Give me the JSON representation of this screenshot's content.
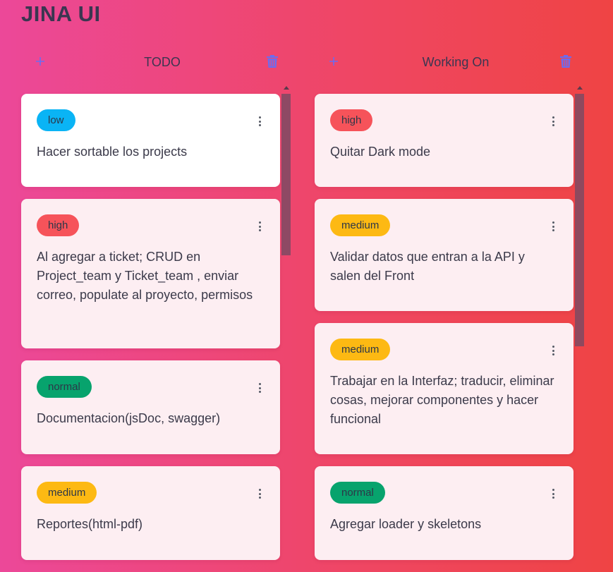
{
  "app": {
    "title": "JINA UI"
  },
  "colors": {
    "add_icon": "#6b6cf0",
    "trash_icon": "#6b6cf0",
    "title": "#3b3651"
  },
  "columns": [
    {
      "title": "TODO",
      "add_icon": "plus-icon",
      "delete_icon": "trash-icon",
      "scroll_position": 0,
      "cards": [
        {
          "priority": "low",
          "text": "Hacer sortable los projects"
        },
        {
          "priority": "high",
          "text": "Al agregar a ticket; CRUD en Project_team y Ticket_team , enviar correo, populate al proyecto, permisos"
        },
        {
          "priority": "normal",
          "text": "Documentacion(jsDoc, swagger)"
        },
        {
          "priority": "medium",
          "text": "Reportes(html-pdf)"
        }
      ]
    },
    {
      "title": "Working On",
      "add_icon": "plus-icon",
      "delete_icon": "trash-icon",
      "scroll_position": 0,
      "cards": [
        {
          "priority": "high",
          "text": "Quitar Dark mode"
        },
        {
          "priority": "medium",
          "text": "Validar datos que entran a la API y salen del Front"
        },
        {
          "priority": "medium",
          "text": "Trabajar en la Interfaz; traducir, eliminar cosas, mejorar componentes y hacer funcional"
        },
        {
          "priority": "normal",
          "text": "Agregar loader y skeletons"
        }
      ]
    }
  ],
  "card_menu_icon": "more-vertical-icon"
}
